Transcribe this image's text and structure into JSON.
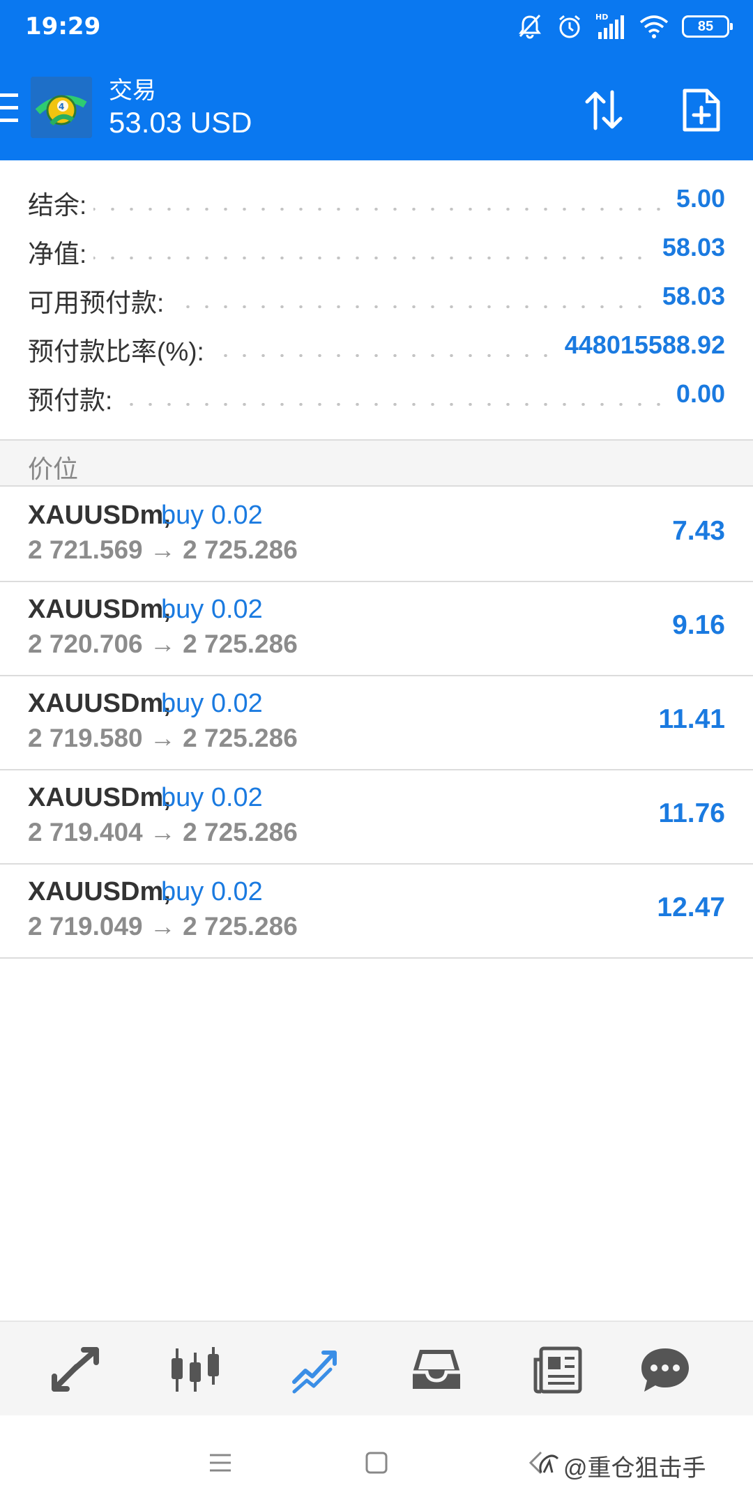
{
  "status_bar": {
    "time": "19:29",
    "battery": "85",
    "icons": [
      "mute-icon",
      "alarm-icon",
      "hd-signal-icon",
      "wifi-icon",
      "battery-icon"
    ]
  },
  "app_bar": {
    "title": "交易",
    "subtitle": "53.03 USD",
    "icons": [
      "menu-icon",
      "metatrader-logo",
      "sort-icon",
      "new-order-icon"
    ]
  },
  "account": {
    "rows": [
      {
        "label": "结余:",
        "value": "5.00"
      },
      {
        "label": "净值:",
        "value": "58.03"
      },
      {
        "label": "可用预付款:",
        "value": "58.03"
      },
      {
        "label": "预付款比率(%):",
        "value": "448015588.92"
      },
      {
        "label": "预付款:",
        "value": "0.00"
      }
    ]
  },
  "positions": {
    "title": "价位",
    "items": [
      {
        "symbol": "XAUUSDm,",
        "type": "buy 0.02",
        "prices": "2 721.569 → 2 725.286",
        "profit": "7.43"
      },
      {
        "symbol": "XAUUSDm,",
        "type": "buy 0.02",
        "prices": "2 720.706 → 2 725.286",
        "profit": "9.16"
      },
      {
        "symbol": "XAUUSDm,",
        "type": "buy 0.02",
        "prices": "2 719.580 → 2 725.286",
        "profit": "11.41"
      },
      {
        "symbol": "XAUUSDm,",
        "type": "buy 0.02",
        "prices": "2 719.404 → 2 725.286",
        "profit": "11.76"
      },
      {
        "symbol": "XAUUSDm,",
        "type": "buy 0.02",
        "prices": "2 719.049 → 2 725.286",
        "profit": "12.47"
      }
    ]
  },
  "bottom_nav": {
    "items": [
      "quotes-icon",
      "chart-icon",
      "trade-icon",
      "history-icon",
      "news-icon",
      "messages-icon"
    ],
    "active": "trade-icon"
  },
  "colors": {
    "primary": "#0a78f0",
    "value_blue": "#1a7ae0",
    "inactive_icon": "#666666"
  },
  "watermark": "@重仓狙击手"
}
